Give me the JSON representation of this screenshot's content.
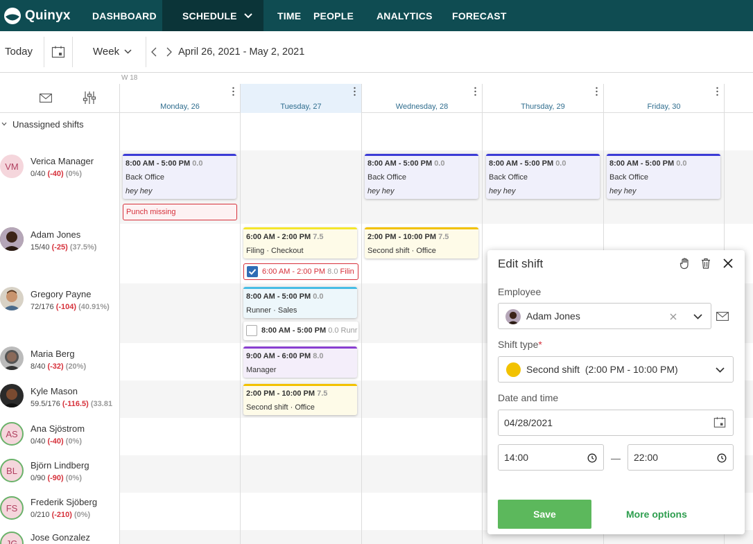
{
  "nav": {
    "logo": "Quinyx",
    "items": [
      {
        "label": "DASHBOARD"
      },
      {
        "label": "SCHEDULE"
      },
      {
        "label": "TIME"
      },
      {
        "label": "PEOPLE"
      },
      {
        "label": "ANALYTICS"
      },
      {
        "label": "FORECAST"
      }
    ]
  },
  "toolbar": {
    "today": "Today",
    "view": "Week",
    "date_range": "April 26, 2021 - May 2, 2021"
  },
  "week_label": "W 18",
  "days": [
    {
      "label": "Monday, 26"
    },
    {
      "label": "Tuesday, 27"
    },
    {
      "label": "Wednesday, 28"
    },
    {
      "label": "Thursday, 29"
    },
    {
      "label": "Friday, 30"
    }
  ],
  "unassigned": "Unassigned shifts",
  "employees": [
    {
      "initials": "VM",
      "name": "Verica Manager",
      "hours": "0/40",
      "diff": "(-40)",
      "pct": "(0%)"
    },
    {
      "initials": "",
      "name": "Adam Jones",
      "hours": "15/40",
      "diff": "(-25)",
      "pct": "(37.5%)"
    },
    {
      "initials": "",
      "name": "Gregory Payne",
      "hours": "72/176",
      "diff": "(-104)",
      "pct": "(40.91%)"
    },
    {
      "initials": "",
      "name": "Maria Berg",
      "hours": "8/40",
      "diff": "(-32)",
      "pct": "(20%)"
    },
    {
      "initials": "",
      "name": "Kyle Mason",
      "hours": "59.5/176",
      "diff": "(-116.5)",
      "pct": "(33.81"
    },
    {
      "initials": "AS",
      "name": "Ana Sjöstrom",
      "hours": "0/40",
      "diff": "(-40)",
      "pct": "(0%)"
    },
    {
      "initials": "BL",
      "name": "Björn Lindberg",
      "hours": "0/90",
      "diff": "(-90)",
      "pct": "(0%)"
    },
    {
      "initials": "FS",
      "name": "Frederik Sjöberg",
      "hours": "0/210",
      "diff": "(-210)",
      "pct": "(0%)"
    },
    {
      "initials": "JG",
      "name": "Jose Gonzalez",
      "hours": "",
      "diff": "",
      "pct": ""
    }
  ],
  "shifts": {
    "vm_mon": {
      "time": "8:00 AM - 5:00 PM",
      "hrs": "0.0",
      "desc": "Back Office",
      "note": "hey hey"
    },
    "vm_wed": {
      "time": "8:00 AM - 5:00 PM",
      "hrs": "0.0",
      "desc": "Back Office",
      "note": "hey hey"
    },
    "vm_thu": {
      "time": "8:00 AM - 5:00 PM",
      "hrs": "0.0",
      "desc": "Back Office",
      "note": "hey hey"
    },
    "vm_fri": {
      "time": "8:00 AM - 5:00 PM",
      "hrs": "0.0",
      "desc": "Back Office",
      "note": "hey hey"
    },
    "punch": "Punch missing",
    "aj_tue": {
      "time": "6:00 AM - 2:00 PM",
      "hrs": "7.5",
      "desc": "Filing · Checkout"
    },
    "aj_tue_sel": {
      "time": "6:00 AM - 2:00 PM",
      "hrs": "8.0",
      "desc": "Filin"
    },
    "aj_wed": {
      "time": "2:00 PM - 10:00 PM",
      "hrs": "7.5",
      "desc": "Second shift · Office"
    },
    "gp_tue": {
      "time": "8:00 AM - 5:00 PM",
      "hrs": "0.0",
      "desc": "Runner · Sales"
    },
    "gp_tue_ghost": {
      "time": "8:00 AM - 5:00 PM",
      "hrs": "0.0",
      "desc": "Runr"
    },
    "mb_tue": {
      "time": "9:00 AM - 6:00 PM",
      "hrs": "8.0",
      "desc": "Manager"
    },
    "km_tue": {
      "time": "2:00 PM - 10:00 PM",
      "hrs": "7.5",
      "desc": "Second shift · Office"
    }
  },
  "panel": {
    "title": "Edit shift",
    "employee_label": "Employee",
    "employee_value": "Adam Jones",
    "shift_type_label": "Shift type",
    "shift_type_required": "*",
    "shift_type_value": "Second shift  (2:00 PM - 10:00 PM)",
    "shift_type_color": "#f2c200",
    "date_time_label": "Date and time",
    "date_value": "04/28/2021",
    "start_time": "14:00",
    "time_separator": "—",
    "end_time": "22:00",
    "save": "Save",
    "more": "More options"
  },
  "colors": {
    "nav_bg": "#0f4c52",
    "nav_active": "#0b3438",
    "manager_shift": "#3b3bd6",
    "checkout_shift": "#f4e62c",
    "second_shift": "#f2c200",
    "runner_shift": "#47bde5",
    "manager_role": "#8a3fd1",
    "danger": "#d6303a",
    "save_green": "#5cb85c"
  }
}
